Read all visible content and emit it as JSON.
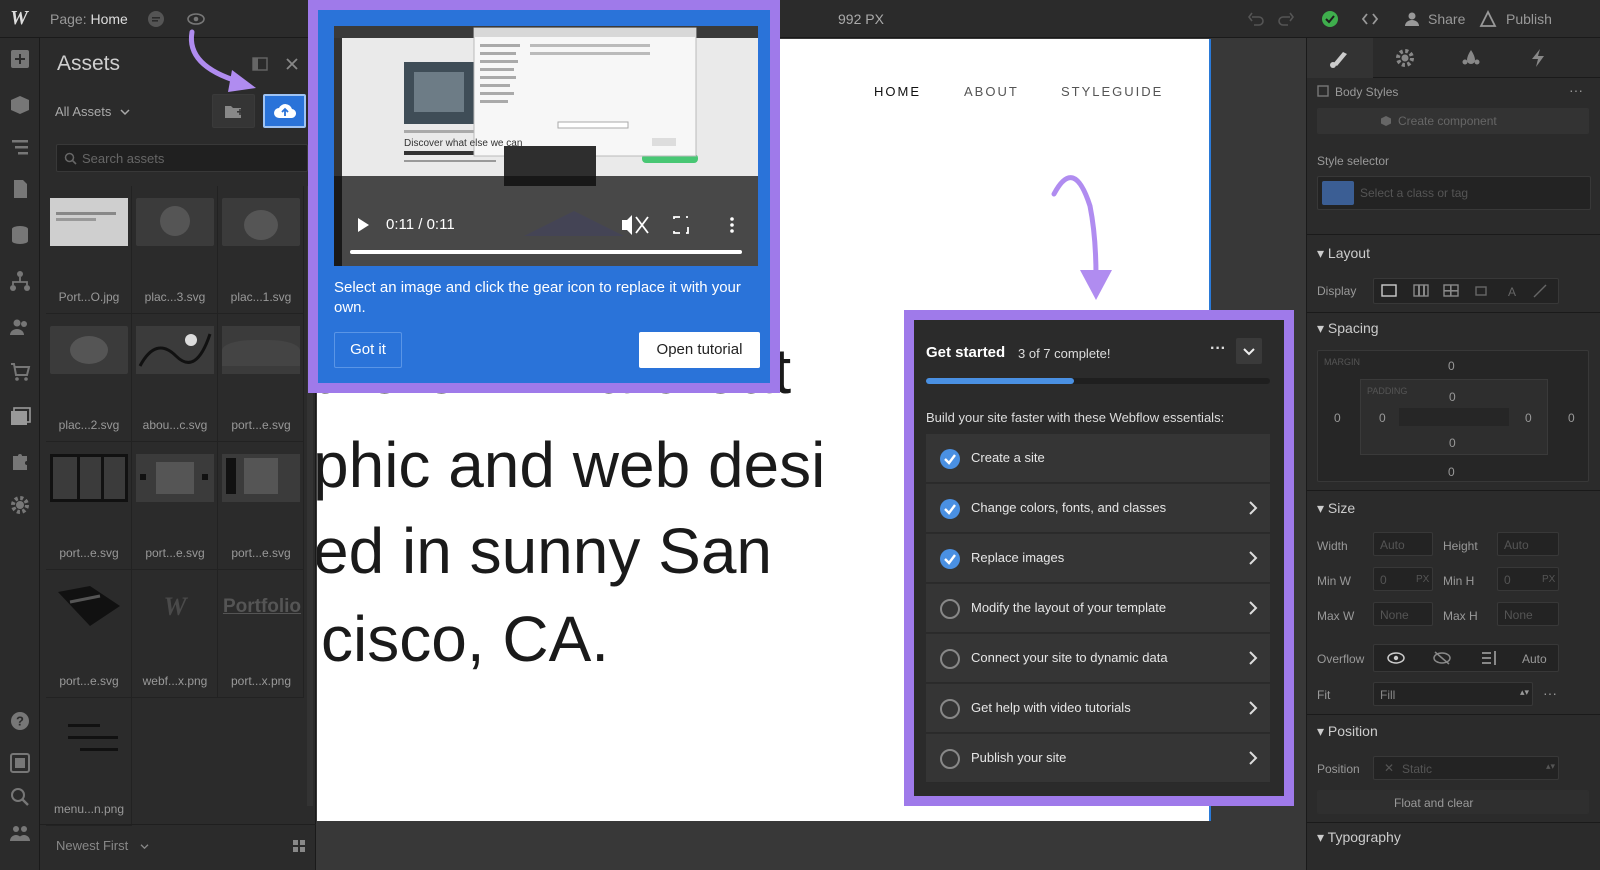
{
  "topbar": {
    "page_label": "Page:",
    "page_name": "Home",
    "width": "992 PX",
    "share": "Share",
    "publish": "Publish"
  },
  "assets": {
    "title": "Assets",
    "filter": "All Assets",
    "search_placeholder": "Search assets",
    "sort": "Newest First",
    "items": [
      "Port...O.jpg",
      "plac...3.svg",
      "plac...1.svg",
      "plac...2.svg",
      "abou...c.svg",
      "port...e.svg",
      "port...e.svg",
      "port...e.svg",
      "port...e.svg",
      "port...e.svg",
      "webf...x.png",
      "port...x.png",
      "menu...n.png"
    ],
    "thumb_text": "Portfolio"
  },
  "site": {
    "nav": [
      "HOME",
      "ABOUT",
      "STYLEGUIDE"
    ],
    "hero_lines": [
      "there. I'm a creat",
      "phic and web desi",
      "ed in sunny San",
      "cisco, CA."
    ]
  },
  "tooltip": {
    "time": "0:11 / 0:11",
    "video_text": "Discover what else we can",
    "description": "Select an image and click the gear icon to replace it with your own.",
    "got_it": "Got it",
    "open_tutorial": "Open tutorial"
  },
  "checklist": {
    "title": "Get started",
    "count": "3 of 7 complete!",
    "progress": 0.43,
    "intro": "Build your site faster with these Webflow essentials:",
    "items": [
      {
        "label": "Create a site",
        "done": true
      },
      {
        "label": "Change colors, fonts, and classes",
        "done": true
      },
      {
        "label": "Replace images",
        "done": true
      },
      {
        "label": "Modify the layout of your template",
        "done": false
      },
      {
        "label": "Connect your site to dynamic data",
        "done": false
      },
      {
        "label": "Get help with video tutorials",
        "done": false
      },
      {
        "label": "Publish your site",
        "done": false
      }
    ]
  },
  "style_panel": {
    "body_styles": "Body Styles",
    "create_component": "Create component",
    "style_selector": "Style selector",
    "selector_placeholder": "Select a class or tag",
    "layout": "Layout",
    "display": "Display",
    "spacing": "Spacing",
    "margin": "MARGIN",
    "padding": "PADDING",
    "zero": "0",
    "size": "Size",
    "width": "Width",
    "height": "Height",
    "auto": "Auto",
    "min_w": "Min W",
    "min_h": "Min H",
    "px": "PX",
    "max_w": "Max W",
    "max_h": "Max H",
    "none": "None",
    "overflow": "Overflow",
    "fit": "Fit",
    "fill": "Fill",
    "position_section": "Position",
    "position_label": "Position",
    "static": "Static",
    "float_clear": "Float and clear",
    "typography": "Typography"
  },
  "colors": {
    "accent": "#9f7aea",
    "blue": "#2a73d9",
    "progress": "#4a90e2",
    "panel": "#2b2b2b"
  }
}
